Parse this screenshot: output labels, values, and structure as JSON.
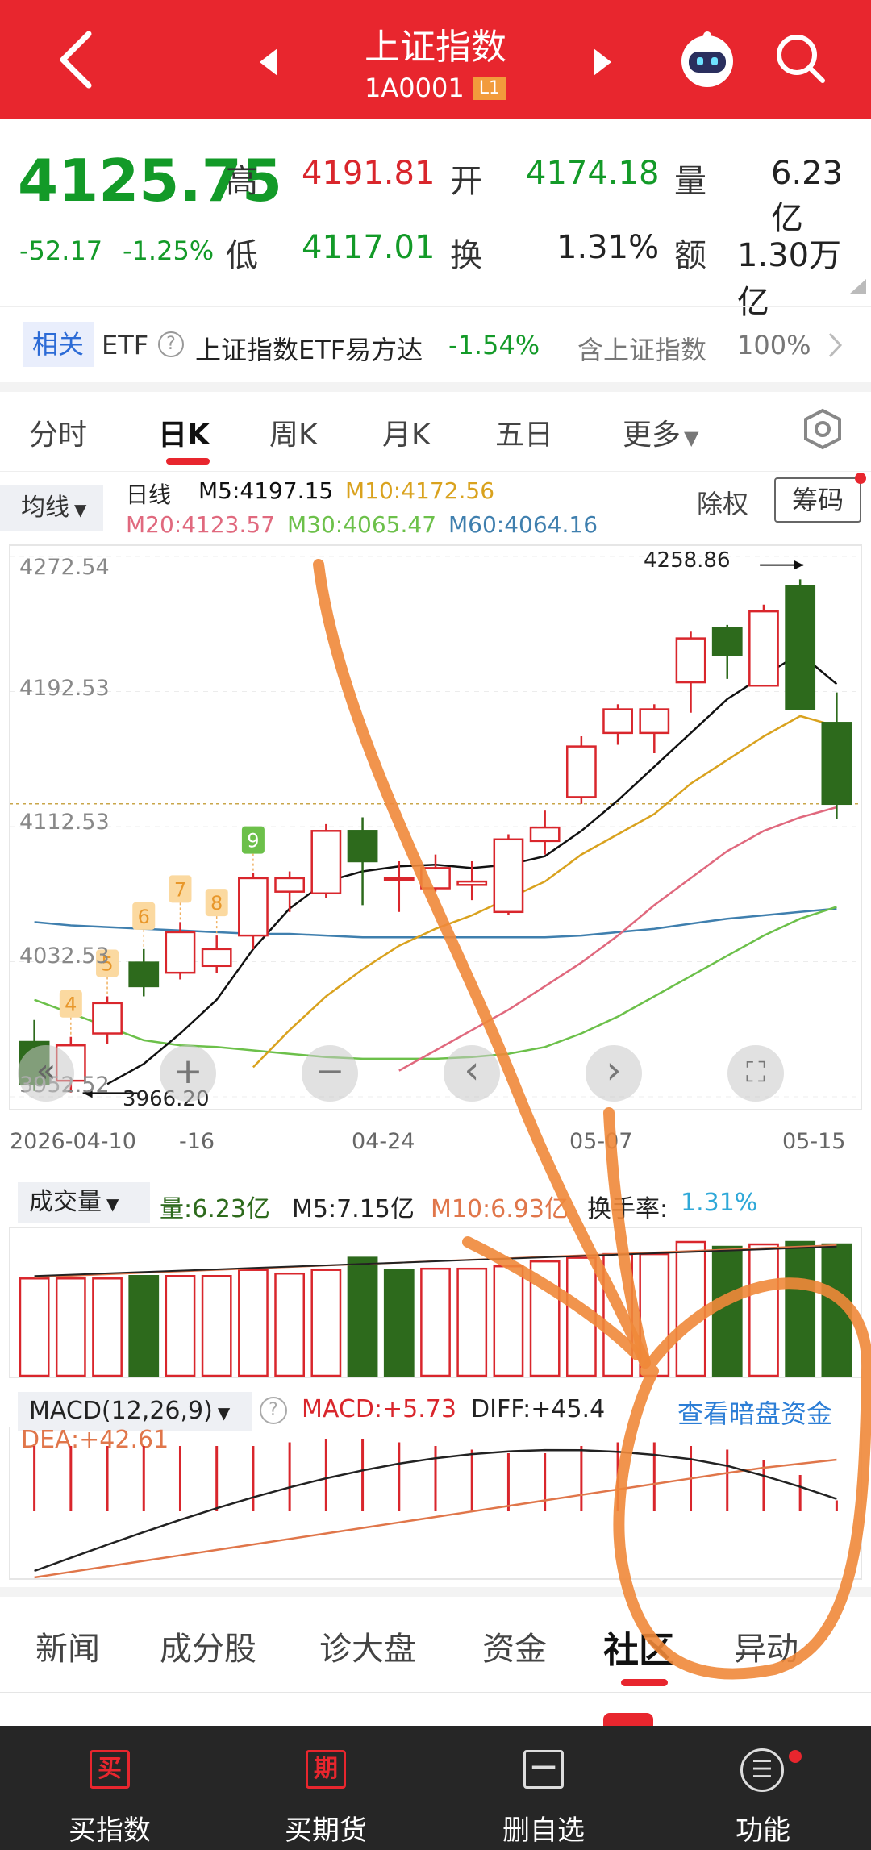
{
  "header": {
    "title": "上证指数",
    "code": "1A0001",
    "badge": "L1"
  },
  "quote": {
    "price": "4125.75",
    "change": "-52.17",
    "change_pct": "-1.25%",
    "high_label": "高",
    "high": "4191.81",
    "low_label": "低",
    "low": "4117.01",
    "open_label": "开",
    "open": "4174.18",
    "turnover_label": "换",
    "turnover": "1.31%",
    "volume_label": "量",
    "volume": "6.23亿",
    "amount_label": "额",
    "amount": "1.30万亿"
  },
  "related": {
    "tag": "相关",
    "etf_label": "ETF",
    "help": "?",
    "etf_name": "上证指数ETF易方达",
    "etf_change": "-1.54%",
    "contains_label": "含上证指数",
    "contains_pct": "100%"
  },
  "tabs": [
    "分时",
    "日K",
    "周K",
    "月K",
    "五日",
    "更多"
  ],
  "active_tab": 1,
  "ma_legend": {
    "selector": "均线",
    "type": "日线",
    "m5": "M5:4197.15",
    "m10": "M10:4172.56",
    "m20": "M20:4123.57",
    "m30": "M30:4065.47",
    "m60": "M60:4064.16",
    "exright": "除权",
    "chips": "筹码"
  },
  "colors": {
    "header_red": "#e8262e",
    "up_red": "#d9262c",
    "down_green": "#139a28",
    "candle_green": "#2d6a1c",
    "ma5": "#111111",
    "ma10": "#d9a21e",
    "ma20": "#e0697e",
    "ma30": "#6cc04a",
    "ma60": "#3f7fae",
    "annotation_orange": "#f0883a"
  },
  "chart_data": {
    "type": "candlestick",
    "y_ticks": [
      "4272.54",
      "4192.53",
      "4112.53",
      "4032.53",
      "3952.52"
    ],
    "ylim": [
      3952.52,
      4272.54
    ],
    "x_labels": [
      "2026-04-10",
      "-16",
      "04-24",
      "05-07",
      "05-15"
    ],
    "max_marker": "4258.86",
    "min_marker": "3966.20",
    "signal_labels": [
      "4",
      "5",
      "6",
      "7",
      "8",
      "9"
    ],
    "candles": [
      {
        "o": 3985,
        "c": 3960,
        "h": 3998,
        "l": 3956
      },
      {
        "o": 3962,
        "c": 3983,
        "h": 3988,
        "l": 3955
      },
      {
        "o": 3990,
        "c": 4008,
        "h": 4012,
        "l": 3984
      },
      {
        "o": 4032,
        "c": 4018,
        "h": 4040,
        "l": 4012
      },
      {
        "o": 4026,
        "c": 4050,
        "h": 4056,
        "l": 4022
      },
      {
        "o": 4030,
        "c": 4040,
        "h": 4048,
        "l": 4026
      },
      {
        "o": 4048,
        "c": 4082,
        "h": 4085,
        "l": 4040
      },
      {
        "o": 4074,
        "c": 4082,
        "h": 4086,
        "l": 4062
      },
      {
        "o": 4073,
        "c": 4110,
        "h": 4114,
        "l": 4070
      },
      {
        "o": 4110,
        "c": 4092,
        "h": 4118,
        "l": 4066
      },
      {
        "o": 4082,
        "c": 4082,
        "h": 4092,
        "l": 4062
      },
      {
        "o": 4076,
        "c": 4088,
        "h": 4096,
        "l": 4074
      },
      {
        "o": 4078,
        "c": 4080,
        "h": 4092,
        "l": 4069
      },
      {
        "o": 4062,
        "c": 4105,
        "h": 4108,
        "l": 4060
      },
      {
        "o": 4104,
        "c": 4112,
        "h": 4122,
        "l": 4096
      },
      {
        "o": 4130,
        "c": 4160,
        "h": 4166,
        "l": 4126
      },
      {
        "o": 4168,
        "c": 4182,
        "h": 4185,
        "l": 4161
      },
      {
        "o": 4168,
        "c": 4182,
        "h": 4185,
        "l": 4156
      },
      {
        "o": 4198,
        "c": 4224,
        "h": 4228,
        "l": 4180
      },
      {
        "o": 4230,
        "c": 4214,
        "h": 4232,
        "l": 4200
      },
      {
        "o": 4196,
        "c": 4240,
        "h": 4244,
        "l": 4196
      },
      {
        "o": 4255,
        "c": 4182,
        "h": 4259,
        "l": 4182
      },
      {
        "o": 4174,
        "c": 4126,
        "h": 4192,
        "l": 4117
      }
    ],
    "ma5": [
      null,
      null,
      3960,
      3972,
      3990,
      4010,
      4040,
      4064,
      4080,
      4086,
      4089,
      4090,
      4088,
      4090,
      4095,
      4110,
      4128,
      4148,
      4168,
      4188,
      4202,
      4215,
      4197
    ],
    "ma10": [
      null,
      null,
      null,
      null,
      null,
      null,
      3970,
      3992,
      4012,
      4028,
      4042,
      4052,
      4060,
      4070,
      4080,
      4096,
      4108,
      4120,
      4138,
      4152,
      4166,
      4178,
      4172
    ],
    "ma20": [
      null,
      null,
      null,
      null,
      null,
      null,
      null,
      null,
      null,
      null,
      3968,
      3980,
      3992,
      4004,
      4018,
      4032,
      4048,
      4066,
      4082,
      4098,
      4110,
      4118,
      4124
    ],
    "ma30": [
      4010,
      4002,
      3994,
      3986,
      3983,
      3982,
      3980,
      3978,
      3976,
      3975,
      3975,
      3975,
      3976,
      3978,
      3982,
      3990,
      4000,
      4012,
      4024,
      4036,
      4048,
      4058,
      4065
    ],
    "ma60": [
      4056,
      4054,
      4053,
      4052,
      4051,
      4050,
      4049,
      4049,
      4048,
      4047,
      4047,
      4047,
      4047,
      4047,
      4047,
      4048,
      4050,
      4052,
      4055,
      4058,
      4060,
      4062,
      4064
    ]
  },
  "chart_controls": {
    "prev": "«",
    "zoom_in": "+",
    "zoom_out": "−",
    "left": "‹",
    "right": "›",
    "fullscreen": "⛶"
  },
  "volume": {
    "selector": "成交量",
    "vol": "量:6.23亿",
    "m5": "M5:7.15亿",
    "m10": "M10:6.93亿",
    "turnover_label": "换手率:",
    "turnover": "1.31%",
    "bars": [
      {
        "v": 0.8,
        "up": true
      },
      {
        "v": 0.8,
        "up": true
      },
      {
        "v": 0.8,
        "up": true
      },
      {
        "v": 0.82,
        "up": false
      },
      {
        "v": 0.82,
        "up": true
      },
      {
        "v": 0.82,
        "up": true
      },
      {
        "v": 0.87,
        "up": true
      },
      {
        "v": 0.84,
        "up": true
      },
      {
        "v": 0.87,
        "up": true
      },
      {
        "v": 0.97,
        "up": false
      },
      {
        "v": 0.87,
        "up": false
      },
      {
        "v": 0.88,
        "up": true
      },
      {
        "v": 0.88,
        "up": true
      },
      {
        "v": 0.9,
        "up": true
      },
      {
        "v": 0.94,
        "up": true
      },
      {
        "v": 0.97,
        "up": true
      },
      {
        "v": 1.0,
        "up": true
      },
      {
        "v": 1.0,
        "up": true
      },
      {
        "v": 1.1,
        "up": true
      },
      {
        "v": 1.06,
        "up": false
      },
      {
        "v": 1.08,
        "up": true
      },
      {
        "v": 1.1,
        "up": false
      },
      {
        "v": 1.08,
        "up": false
      }
    ]
  },
  "macd": {
    "selector": "MACD(12,26,9)",
    "help": "?",
    "macd": "MACD:+5.73",
    "diff": "DIFF:+45.4",
    "dea": "DEA:+42.61",
    "link": "查看暗盘资金",
    "hist": [
      0.9,
      0.9,
      0.9,
      0.9,
      0.9,
      0.9,
      0.9,
      0.95,
      1,
      1,
      0.95,
      0.9,
      0.85,
      0.8,
      0.8,
      0.9,
      0.95,
      0.95,
      0.9,
      0.85,
      0.7,
      0.5,
      0.15
    ]
  },
  "bottom_tabs": [
    "新闻",
    "成分股",
    "诊大盘",
    "资金",
    "社区",
    "异动"
  ],
  "bottom_active": 4,
  "bottom_nav": [
    {
      "label": "买指数",
      "icon_char": "买"
    },
    {
      "label": "买期货",
      "icon_char": "期"
    },
    {
      "label": "删自选",
      "icon_char": "一"
    },
    {
      "label": "功能",
      "icon_char": "☰"
    }
  ]
}
